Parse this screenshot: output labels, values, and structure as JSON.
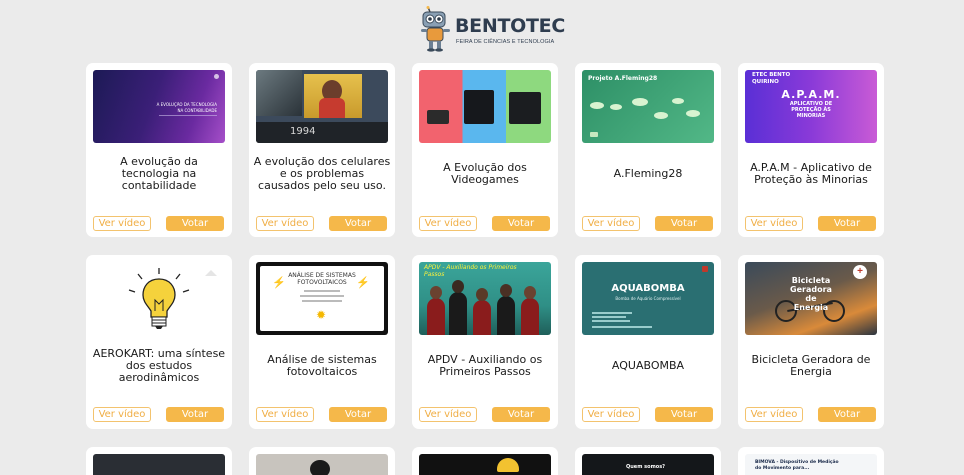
{
  "header": {
    "brand": "BENTOTEC",
    "subtitle": "FEIRA DE CIÊNCIAS E TECNOLOGIA"
  },
  "buttons": {
    "video": "Ver vídeo",
    "vote": "Votar"
  },
  "projects": [
    {
      "title": "A evolução da tecnologia na contabilidade",
      "thumb_text": [
        "A EVOLUÇÃO DA TECNOLOGIA",
        "NA CONTABILIDADE"
      ]
    },
    {
      "title": "A evolução dos celulares e os problemas causados pelo seu uso.",
      "thumb_text": [
        "1994"
      ]
    },
    {
      "title": "A Evolução dos Videogames",
      "thumb_text": []
    },
    {
      "title": "A.Fleming28",
      "thumb_text": [
        "Projeto A.Fleming28"
      ]
    },
    {
      "title": "A.P.A.M - Aplicativo de Proteção às Minorias",
      "thumb_text": [
        "ETEC BENTO",
        "QUIRINO",
        "A.P.A.M.",
        "APLICATIVO DE",
        "PROTEÇÃO ÀS",
        "MINORIAS"
      ]
    },
    {
      "title": "AEROKART: uma síntese dos estudos aerodinâmicos",
      "thumb_text": []
    },
    {
      "title": "Análise de sistemas fotovoltaicos",
      "thumb_text": [
        "ANÁLISE DE SISTEMAS",
        "FOTOVOLTAICOS"
      ]
    },
    {
      "title": "APDV - Auxiliando os Primeiros Passos",
      "thumb_text": [
        "APDV - Auxiliando os Primeiros",
        "Passos"
      ]
    },
    {
      "title": "AQUABOMBA",
      "thumb_text": [
        "AQUABOMBA",
        "Bomba de Aquário Compressível"
      ]
    },
    {
      "title": "Bicicleta Geradora de Energia",
      "thumb_text": [
        "Bicicleta",
        "Geradora",
        "de",
        "Energia"
      ]
    },
    {
      "thumb_text": []
    },
    {
      "thumb_text": []
    },
    {
      "thumb_text": []
    },
    {
      "thumb_text": [
        "Quem somos?"
      ]
    },
    {
      "thumb_text": [
        "BIMOVA - Dispositivo de Medição",
        "do Movimento para..."
      ]
    }
  ]
}
